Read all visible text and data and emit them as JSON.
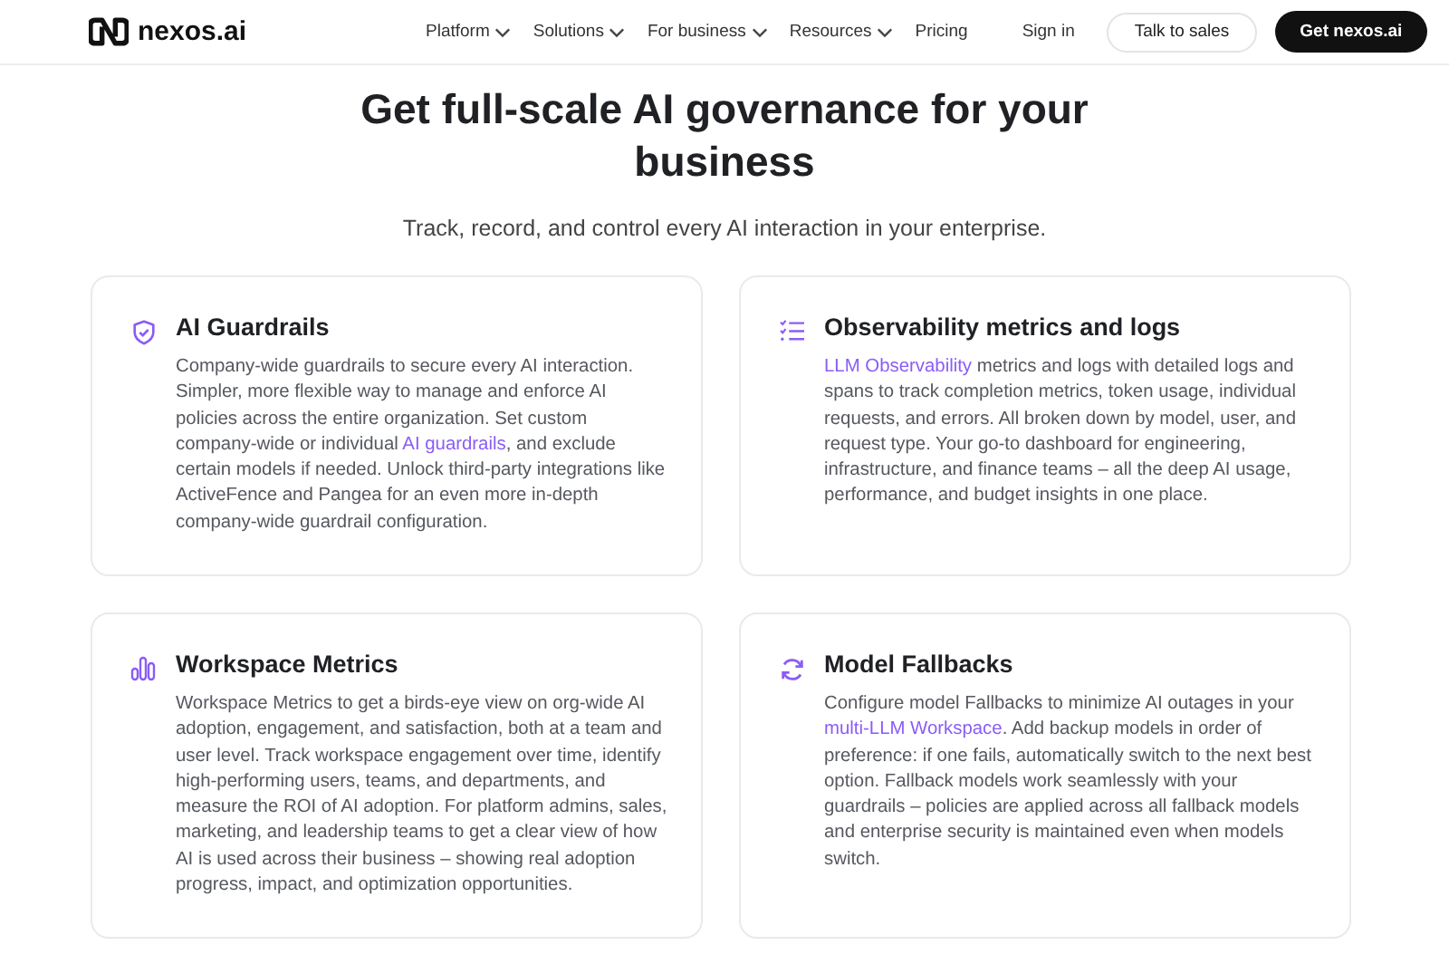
{
  "header": {
    "logo": "nexos.ai",
    "nav": [
      {
        "label": "Platform",
        "dropdown": true
      },
      {
        "label": "Solutions",
        "dropdown": true
      },
      {
        "label": "For business",
        "dropdown": true
      },
      {
        "label": "Resources",
        "dropdown": true
      },
      {
        "label": "Pricing",
        "dropdown": false
      }
    ],
    "sign_in": "Sign in",
    "talk_to_sales": "Talk to sales",
    "cta": "Get nexos.ai"
  },
  "hero": {
    "title": "Get full-scale AI governance for your business",
    "subtitle": "Track, record, and control every AI interaction in your enterprise."
  },
  "cards": [
    {
      "title": "AI Guardrails",
      "body": [
        {
          "kind": "text",
          "text": "Company-wide guardrails to secure every AI interaction. Simpler, more flexible way to manage and enforce AI policies across the entire organization. Set custom company-wide or individual "
        },
        {
          "kind": "link",
          "text": "AI guardrails"
        },
        {
          "kind": "text",
          "text": ", and exclude certain models if needed. Unlock third-party integrations like ActiveFence and Pangea for an even more in-depth company-wide guardrail configuration."
        }
      ]
    },
    {
      "title": "Observability metrics and logs",
      "body": [
        {
          "kind": "link",
          "text": "LLM Observability"
        },
        {
          "kind": "text",
          "text": " metrics and logs with detailed logs and spans to track completion metrics, token usage, individual requests, and errors. All broken down by model, user, and request type. Your go-to dashboard for engineering, infrastructure, and finance teams – all the deep AI usage, performance, and budget insights in one place."
        }
      ]
    },
    {
      "title": "Workspace Metrics",
      "body": [
        {
          "kind": "text",
          "text": "Workspace Metrics to get a birds-eye view on org-wide AI adoption, engagement, and satisfaction, both at a team and user level. Track workspace engagement over time, identify high-performing users, teams, and departments, and measure the ROI of AI adoption. For platform admins, sales, marketing, and leadership teams to get a clear view of how AI is used across their business – showing real adoption progress, impact, and optimization opportunities."
        }
      ]
    },
    {
      "title": "Model Fallbacks",
      "body": [
        {
          "kind": "text",
          "text": "Configure model Fallbacks to minimize AI outages in your "
        },
        {
          "kind": "link",
          "text": "multi-LLM Workspace"
        },
        {
          "kind": "text",
          "text": ". Add backup models in order of preference: if one fails, automatically switch to the next best option. Fallback models work seamlessly with your guardrails – policies are applied across all fallback models and enterprise security is maintained even when models switch."
        }
      ]
    }
  ]
}
